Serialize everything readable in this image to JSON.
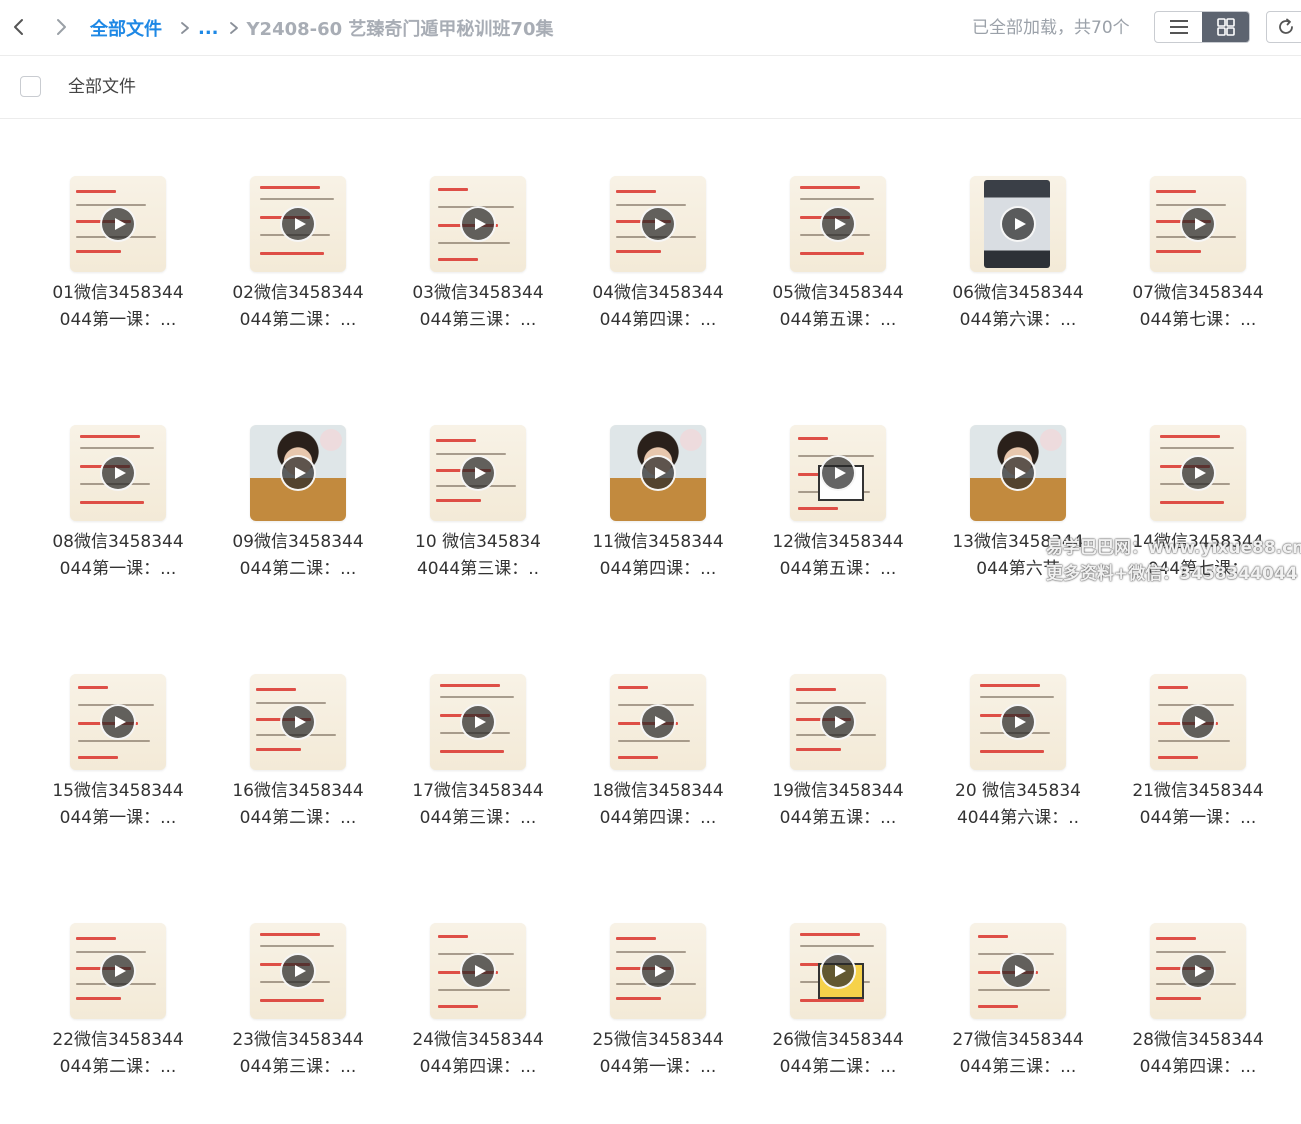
{
  "toolbar": {
    "back_icon": "chevron-left-icon",
    "forward_icon": "chevron-right-icon",
    "breadcrumb_root": "全部文件",
    "breadcrumb_ellipsis": "...",
    "breadcrumb_current": "Y2408-60 艺臻奇门遁甲秘训班70集",
    "load_status": "已全部加载，共70个",
    "list_view_icon": "list-icon",
    "grid_view_icon": "grid-icon",
    "refresh_icon": "refresh-icon"
  },
  "header": {
    "column_label": "全部文件"
  },
  "files": [
    {
      "line1": "01微信3458344",
      "line2": "044第一课：...",
      "thumb": "paper"
    },
    {
      "line1": "02微信3458344",
      "line2": "044第二课：...",
      "thumb": "paper"
    },
    {
      "line1": "03微信3458344",
      "line2": "044第三课：...",
      "thumb": "paper"
    },
    {
      "line1": "04微信3458344",
      "line2": "044第四课：...",
      "thumb": "paper"
    },
    {
      "line1": "05微信3458344",
      "line2": "044第五课：...",
      "thumb": "paper"
    },
    {
      "line1": "06微信3458344",
      "line2": "044第六课：...",
      "thumb": "machine"
    },
    {
      "line1": "07微信3458344",
      "line2": "044第七课：...",
      "thumb": "paper"
    },
    {
      "line1": "08微信3458344",
      "line2": "044第一课：...",
      "thumb": "paper"
    },
    {
      "line1": "09微信3458344",
      "line2": "044第二课：...",
      "thumb": "person"
    },
    {
      "line1": "10 微信345834",
      "line2": "4044第三课：..",
      "thumb": "paper"
    },
    {
      "line1": "11微信3458344",
      "line2": "044第四课：...",
      "thumb": "person"
    },
    {
      "line1": "12微信3458344",
      "line2": "044第五课：...",
      "thumb": "grid"
    },
    {
      "line1": "13微信3458344",
      "line2": "044第六节",
      "thumb": "person"
    },
    {
      "line1": "14微信3458344",
      "line2": "044第七课：",
      "thumb": "paper"
    },
    {
      "line1": "15微信3458344",
      "line2": "044第一课：...",
      "thumb": "paper"
    },
    {
      "line1": "16微信3458344",
      "line2": "044第二课：...",
      "thumb": "paper"
    },
    {
      "line1": "17微信3458344",
      "line2": "044第三课：...",
      "thumb": "paper"
    },
    {
      "line1": "18微信3458344",
      "line2": "044第四课：...",
      "thumb": "paper"
    },
    {
      "line1": "19微信3458344",
      "line2": "044第五课：...",
      "thumb": "paper"
    },
    {
      "line1": "20 微信345834",
      "line2": "4044第六课：..",
      "thumb": "paper"
    },
    {
      "line1": "21微信3458344",
      "line2": "044第一课：...",
      "thumb": "paper"
    },
    {
      "line1": "22微信3458344",
      "line2": "044第二课：...",
      "thumb": "paper"
    },
    {
      "line1": "23微信3458344",
      "line2": "044第三课：...",
      "thumb": "paper"
    },
    {
      "line1": "24微信3458344",
      "line2": "044第四课：...",
      "thumb": "paper"
    },
    {
      "line1": "25微信3458344",
      "line2": "044第一课：...",
      "thumb": "paper"
    },
    {
      "line1": "26微信3458344",
      "line2": "044第二课：...",
      "thumb": "grid-yellow"
    },
    {
      "line1": "27微信3458344",
      "line2": "044第三课：...",
      "thumb": "paper"
    },
    {
      "line1": "28微信3458344",
      "line2": "044第四课：...",
      "thumb": "paper"
    }
  ],
  "watermark": {
    "line1": "易学巴巴网：www.yixue88.cn",
    "line2": "更多资料+微信：3458344044"
  },
  "colors": {
    "accent": "#1e88e5",
    "muted": "#a8adb5",
    "thumb_red": "#d9322b"
  }
}
